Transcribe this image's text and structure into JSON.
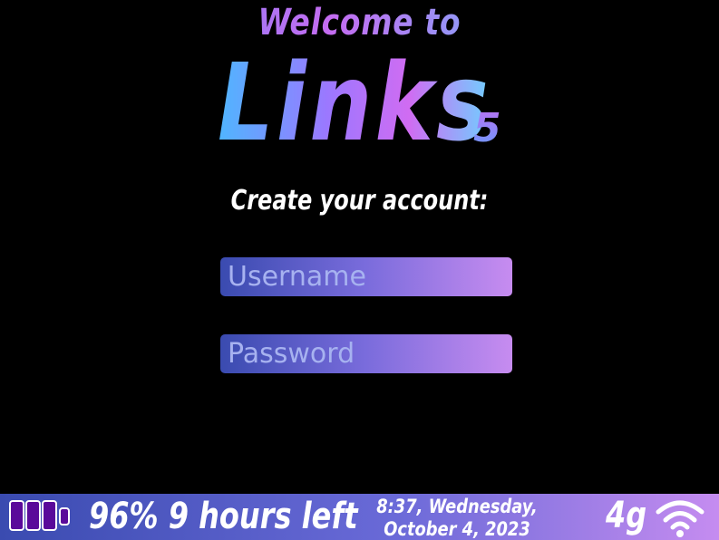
{
  "header": {
    "welcome": "Welcome to",
    "app_name": "Links",
    "version": "5",
    "subtitle": "Create your account:"
  },
  "form": {
    "username_placeholder": "Username",
    "password_placeholder": "Password"
  },
  "statusbar": {
    "battery_icon": "battery-icon",
    "battery_percent": 96,
    "battery_text": "96% 9 hours left",
    "clock_text": "8:37, Wednesday, October 4, 2023",
    "network_text": "4g",
    "wifi_icon": "wifi-icon"
  },
  "colors": {
    "background": "#000000",
    "field_gradient_start": "#3a4bb0",
    "field_gradient_end": "#c78cf0",
    "placeholder": "#a7b2f0",
    "battery_cell": "#5a0a9a"
  }
}
